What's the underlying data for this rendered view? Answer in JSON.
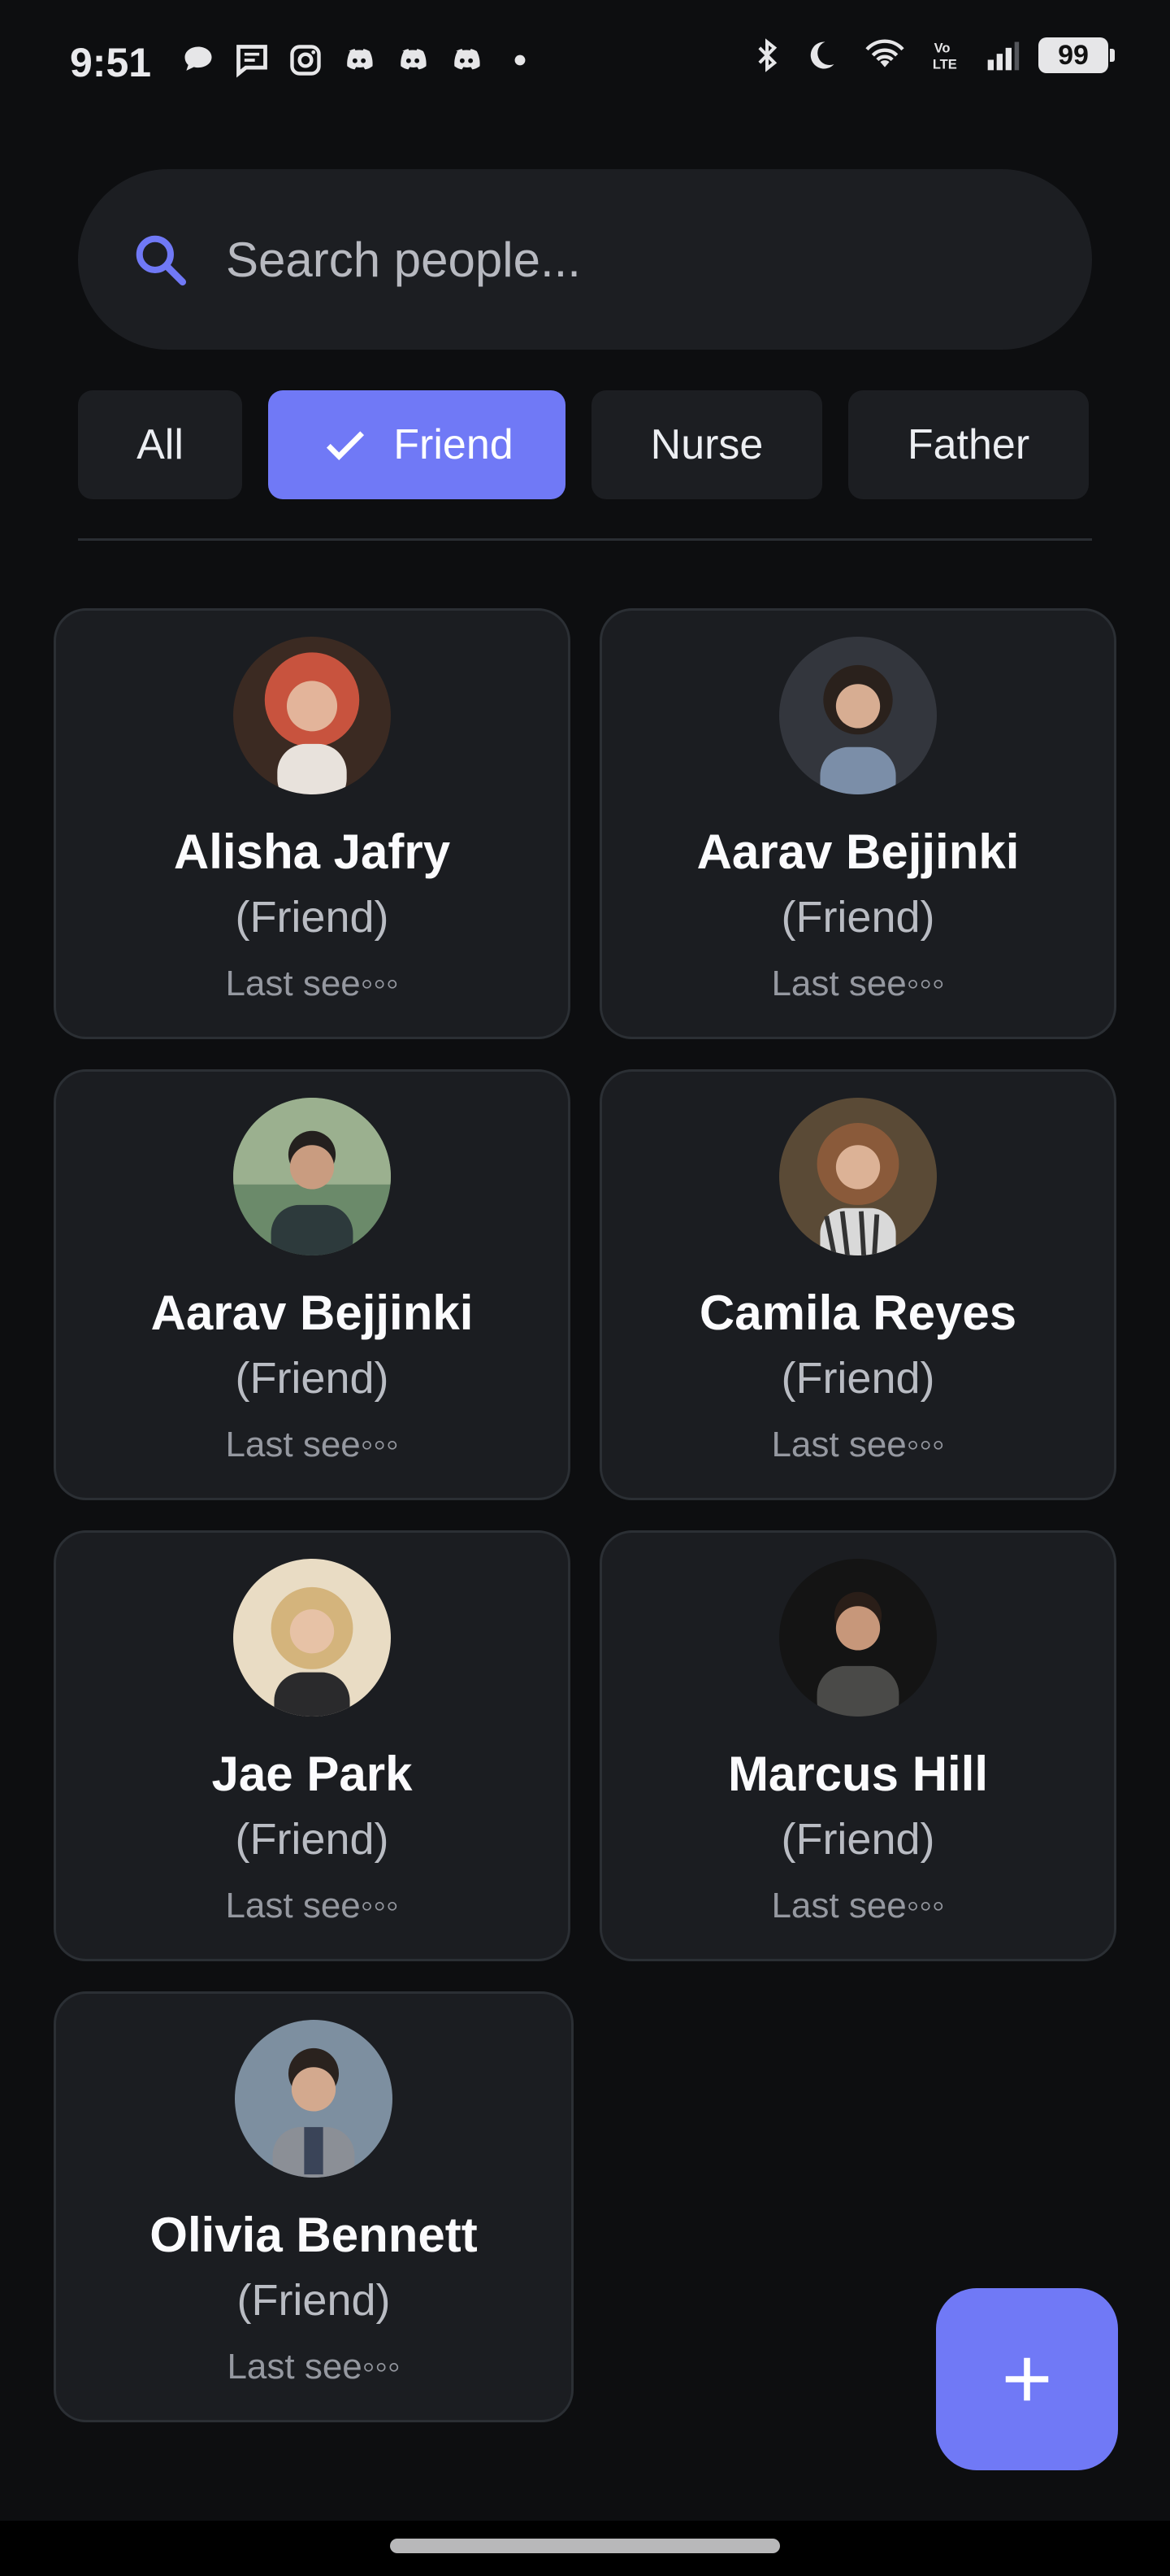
{
  "status_bar": {
    "time": "9:51",
    "battery": "99",
    "left_icons": [
      "chat-bubble-icon",
      "message-icon",
      "instagram-icon",
      "discord-icon",
      "discord-icon",
      "discord-icon",
      "dot-icon"
    ],
    "right_icons": [
      "bluetooth-icon",
      "moon-icon",
      "wifi-icon",
      "volte-icon",
      "signal-icon",
      "battery-icon"
    ]
  },
  "search": {
    "placeholder": "Search people...",
    "icon": "search-icon"
  },
  "filters": {
    "chips": [
      {
        "label": "All",
        "selected": false
      },
      {
        "label": "Friend",
        "selected": true
      },
      {
        "label": "Nurse",
        "selected": false
      },
      {
        "label": "Father",
        "selected": false
      }
    ]
  },
  "people": [
    {
      "name": "Alisha Jafry",
      "relation": "(Friend)",
      "last_seen": "Last see◦◦◦",
      "avatar_color": "#c8533e"
    },
    {
      "name": "Aarav Bejjinki",
      "relation": "(Friend)",
      "last_seen": "Last see◦◦◦",
      "avatar_color": "#4a4d56"
    },
    {
      "name": "Aarav Bejjinki",
      "relation": "(Friend)",
      "last_seen": "Last see◦◦◦",
      "avatar_color": "#6b8a6a"
    },
    {
      "name": "Camila Reyes",
      "relation": "(Friend)",
      "last_seen": "Last see◦◦◦",
      "avatar_color": "#8a6a4a"
    },
    {
      "name": "Jae Park",
      "relation": "(Friend)",
      "last_seen": "Last see◦◦◦",
      "avatar_color": "#c9a878"
    },
    {
      "name": "Marcus Hill",
      "relation": "(Friend)",
      "last_seen": "Last see◦◦◦",
      "avatar_color": "#2b2b2d"
    },
    {
      "name": "Olivia Bennett",
      "relation": "(Friend)",
      "last_seen": "Last see◦◦◦",
      "avatar_color": "#7d8fa0"
    }
  ],
  "fab": {
    "icon": "plus-icon"
  },
  "theme": {
    "accent": "#7079f6",
    "background": "#0d0e10",
    "card": "#1b1d21"
  }
}
